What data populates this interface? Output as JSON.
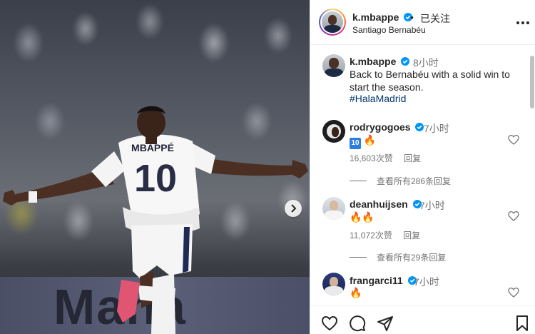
{
  "post": {
    "username": "k.mbappe",
    "separator": "•",
    "follow_status": "已关注",
    "location": "Santiago Bernabéu",
    "jersey_name": "MBAPPÉ",
    "jersey_number": "10",
    "banner_text": "Maha"
  },
  "caption": {
    "username": "k.mbappe",
    "time": "8小时",
    "text": "Back to Bernabéu with a solid win to start the season.",
    "hashtag": "#HalaMadrid"
  },
  "comments": [
    {
      "username": "rodrygogoes",
      "time": "7小时",
      "badge": "10",
      "emoji": "🔥",
      "likes": "16,603次赞",
      "reply": "回复",
      "view_replies": "查看所有286条回复"
    },
    {
      "username": "deanhuijsen",
      "time": "7小时",
      "emoji": "🔥🔥",
      "likes": "11,072次赞",
      "reply": "回复",
      "view_replies": "查看所有29条回复"
    },
    {
      "username": "frangarci11",
      "time": "7小时",
      "emoji": "🔥"
    }
  ],
  "icons": {
    "more": "more-options-icon",
    "like": "heart-icon",
    "comment": "comment-icon",
    "share": "share-icon",
    "save": "bookmark-icon",
    "next": "chevron-right-icon"
  },
  "colors": {
    "verified": "#0095f6",
    "link": "#00376b",
    "muted": "#737373"
  }
}
